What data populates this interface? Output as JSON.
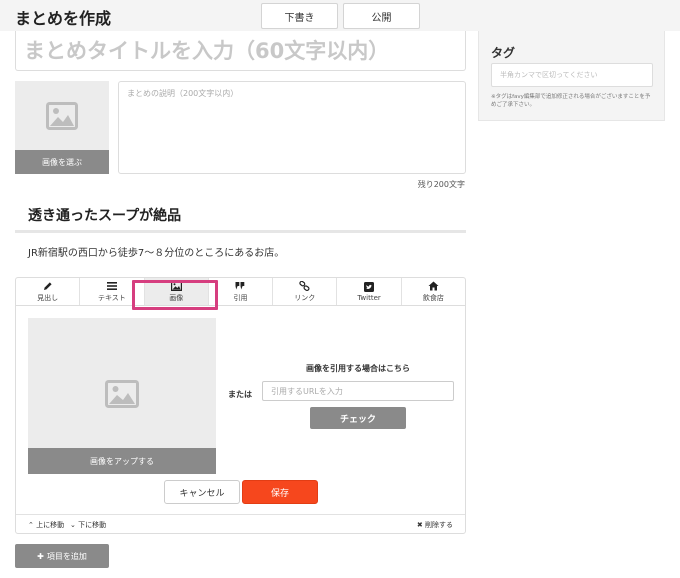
{
  "header": {
    "title": "まとめを作成",
    "draft_label": "下書き",
    "publish_label": "公開"
  },
  "form": {
    "title_placeholder": "まとめタイトルを入力（60文字以内）",
    "image_pick_label": "画像を選ぶ",
    "description_placeholder": "まとめの説明（200文字以内）",
    "remaining_chars": "残り200文字"
  },
  "content": {
    "heading": "透き通ったスープが絶品",
    "text": "JR新宿駅の西口から徒歩7～８分位のところにあるお店。"
  },
  "editor": {
    "tabs": [
      {
        "label": "見出し",
        "icon": "pencil-icon"
      },
      {
        "label": "テキスト",
        "icon": "list-icon"
      },
      {
        "label": "画像",
        "icon": "image-icon"
      },
      {
        "label": "引用",
        "icon": "quote-icon"
      },
      {
        "label": "リンク",
        "icon": "link-icon"
      },
      {
        "label": "Twitter",
        "icon": "twitter-icon"
      },
      {
        "label": "飲食店",
        "icon": "home-icon"
      }
    ],
    "active_tab": "画像",
    "upload_label": "画像をアップする",
    "or_label": "または",
    "quote_title": "画像を引用する場合はこちら",
    "url_placeholder": "引用するURLを入力",
    "check_label": "チェック",
    "cancel_label": "キャンセル",
    "save_label": "保存",
    "move_up_label": "上に移動",
    "move_down_label": "下に移動",
    "delete_label": "削除する"
  },
  "add_item_label": "項目を追加",
  "sidebar": {
    "tag_label": "タグ",
    "tag_placeholder": "半角カンマで区切ってください",
    "tag_note": "※タグはfavy編集部で追加修正される場合がございますことを予めご了承下さい。"
  },
  "colors": {
    "accent_save": "#f6471d",
    "highlight": "#d63e7f",
    "gray_button": "#8a8a8a"
  }
}
